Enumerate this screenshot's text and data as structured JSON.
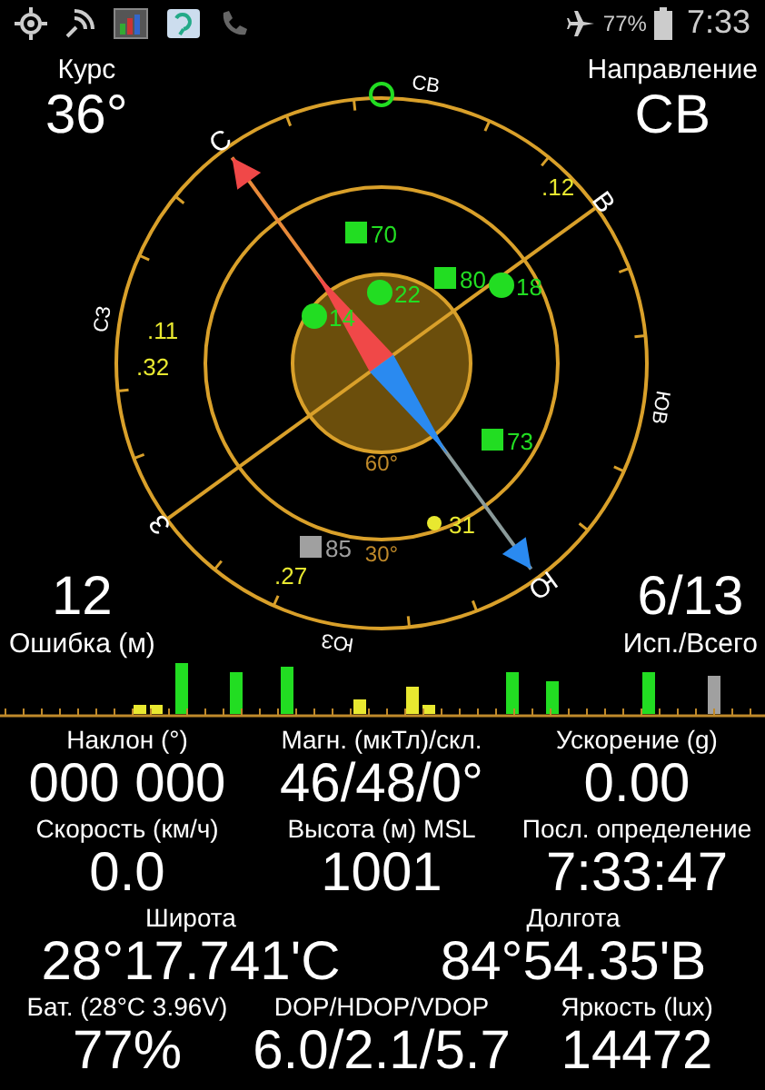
{
  "status_bar": {
    "battery": "77%",
    "time": "7:33"
  },
  "heading": {
    "label": "Курс",
    "value": "36°"
  },
  "direction": {
    "label": "Направление",
    "value": "СВ"
  },
  "compass": {
    "directions": [
      "С",
      "СВ",
      "В",
      "ЮВ",
      "Ю",
      "ЮЗ",
      "З",
      "СЗ"
    ],
    "rings": [
      "60°",
      "30°"
    ],
    "satellites": [
      {
        "label": ".12",
        "kind": "dot",
        "color": "#e8e830"
      },
      {
        "label": "70",
        "kind": "square",
        "color": "#22dd22"
      },
      {
        "label": "22",
        "kind": "circle",
        "color": "#22dd22"
      },
      {
        "label": "80",
        "kind": "square",
        "color": "#22dd22"
      },
      {
        "label": "18",
        "kind": "circle",
        "color": "#22dd22"
      },
      {
        "label": "14",
        "kind": "circle",
        "color": "#22dd22"
      },
      {
        "label": ".11",
        "kind": "dot",
        "color": "#e8e830"
      },
      {
        "label": ".32",
        "kind": "dot",
        "color": "#e8e830"
      },
      {
        "label": "73",
        "kind": "square",
        "color": "#22dd22"
      },
      {
        "label": "31",
        "kind": "circle",
        "color": "#e8e830"
      },
      {
        "label": "85",
        "kind": "square",
        "color": "#a0a0a0"
      },
      {
        "label": ".27",
        "kind": "dot",
        "color": "#e8e830"
      }
    ]
  },
  "error": {
    "value": "12",
    "label": "Ошибка (м)"
  },
  "satellites_count": {
    "value": "6/13",
    "label": "Исп./Всего"
  },
  "readings": [
    [
      {
        "label": "Наклон (°)",
        "value": "000 000"
      },
      {
        "label": "Магн. (мкТл)/скл.",
        "value": "46/48/0°"
      },
      {
        "label": "Ускорение (g)",
        "value": "0.00"
      }
    ],
    [
      {
        "label": "Скорость (км/ч)",
        "value": "0.0"
      },
      {
        "label": "Высота (м) MSL",
        "value": "1001"
      },
      {
        "label": "Посл. определение",
        "value": "7:33:47"
      }
    ],
    [
      {
        "label": "Широта",
        "value": "28°17.741'С"
      },
      {
        "label": "Долгота",
        "value": "84°54.35'В"
      }
    ],
    [
      {
        "label": "Бат. (28°C 3.96V)",
        "value": "77%"
      },
      {
        "label": "DOP/HDOP/VDOP",
        "value": "6.0/2.1/5.7"
      },
      {
        "label": "Яркость (lux)",
        "value": "14472"
      }
    ]
  ]
}
